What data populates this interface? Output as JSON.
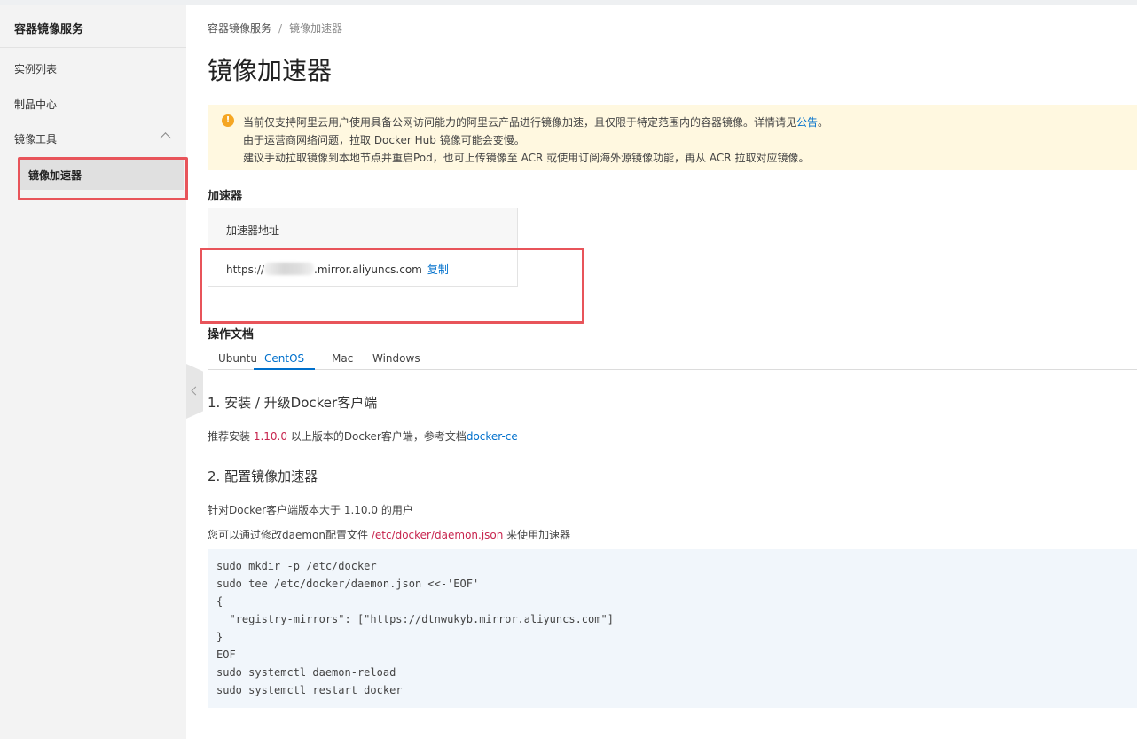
{
  "sidebar": {
    "title": "容器镜像服务",
    "items": [
      {
        "label": "实例列表"
      },
      {
        "label": "制品中心"
      }
    ],
    "group": {
      "label": "镜像工具",
      "expanded": true
    },
    "active_item": {
      "label": "镜像加速器"
    }
  },
  "breadcrumb": {
    "root": "容器镜像服务",
    "separator": "/",
    "current": "镜像加速器"
  },
  "page_title": "镜像加速器",
  "notice": {
    "line1": "当前仅支持阿里云用户使用具备公网访问能力的阿里云产品进行镜像加速，且仅限于特定范围内的容器镜像。详情请见",
    "line1_link": "公告",
    "line1_end": "。",
    "line2": "由于运营商网络问题，拉取 Docker Hub 镜像可能会变慢。",
    "line3": "建议手动拉取镜像到本地节点并重启Pod，也可上传镜像至 ACR 或使用订阅海外源镜像功能，再从 ACR 拉取对应镜像。"
  },
  "accelerator": {
    "section_title": "加速器",
    "header": "加速器地址",
    "url_prefix": "https://",
    "url_suffix": ".mirror.aliyuncs.com",
    "copy_label": "复制"
  },
  "docs": {
    "section_title": "操作文档",
    "tabs": [
      "Ubuntu",
      "CentOS",
      "Mac",
      "Windows"
    ],
    "active_tab": "CentOS"
  },
  "step1": {
    "heading": "1. 安装 / 升级Docker客户端",
    "text_before": "推荐安装 ",
    "version": "1.10.0",
    "text_after": " 以上版本的Docker客户端，参考文档",
    "link": "docker-ce"
  },
  "step2": {
    "heading": "2. 配置镜像加速器",
    "line1": "针对Docker客户端版本大于 1.10.0 的用户",
    "line2_before": "您可以通过修改daemon配置文件 ",
    "line2_path": "/etc/docker/daemon.json",
    "line2_after": " 来使用加速器",
    "code": [
      "sudo mkdir -p /etc/docker",
      "sudo tee /etc/docker/daemon.json <<-'EOF'",
      "{",
      "  \"registry-mirrors\": [\"https://dtnwukyb.mirror.aliyuncs.com\"]",
      "}",
      "EOF",
      "sudo systemctl daemon-reload",
      "sudo systemctl restart docker"
    ]
  },
  "colors": {
    "link": "#0070cc",
    "highlight_box": "#e8545a",
    "notice_bg": "#fff8e0",
    "warning_icon": "#f5a623",
    "code_bg": "#f1f6fb",
    "sidebar_bg": "#f3f3f3"
  },
  "icons": {
    "notice": "warning-icon",
    "group_toggle": "chevron-up-icon",
    "sidebar_collapse": "chevron-left-icon"
  }
}
